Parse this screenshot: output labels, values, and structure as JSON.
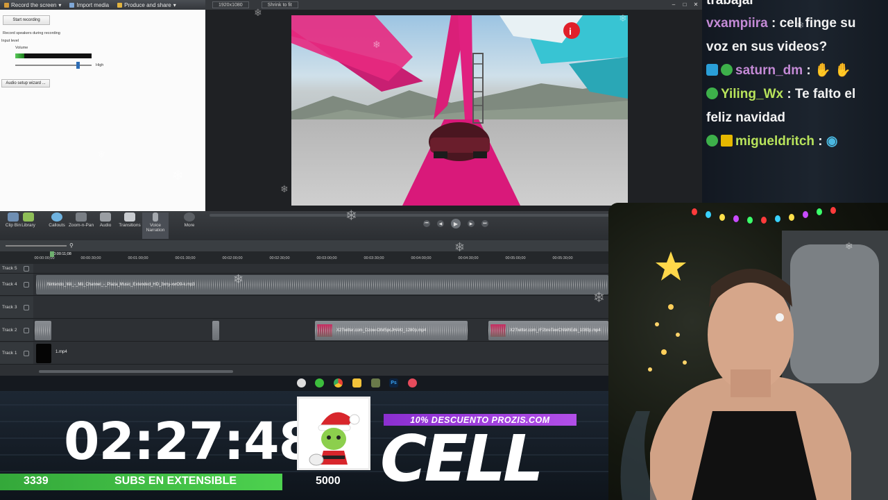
{
  "editor": {
    "menu": [
      "Record the screen",
      "Import media",
      "Produce and share"
    ],
    "recorder": {
      "start_button": "Start recording",
      "speakers_label": "Record speakers during recording",
      "input_level_label": "Input level",
      "volume_label": "Volume",
      "high_label": "High",
      "audio_setup_button": "Audio setup wizard ..."
    },
    "preview": {
      "resolution": "1920x1080",
      "fit": "Shrink to fit"
    },
    "tools": [
      "Clip Bin",
      "Library",
      "Callouts",
      "Zoom-n-Pan",
      "Audio",
      "Transitions",
      "Voice Narration",
      "More"
    ],
    "timeline": {
      "ticks": [
        "00:00:00;00",
        "00:00:30;00",
        "00:01:00;00",
        "00:01:30;00",
        "00:02:00;00",
        "00:02:30;00",
        "00:03:00;00",
        "00:03:30;00",
        "00:04:00;00",
        "00:04:30;00",
        "00:05:00;00",
        "00:05:30;00"
      ],
      "playhead_time": "0:00:11;08",
      "tracks": [
        {
          "label": "Track 5"
        },
        {
          "label": "Track 4",
          "clip": "Nintendo_Wii_-_Mii_Channel_-_Plaza_Music_Extended_HD_3xny-xwO9-k.mp3"
        },
        {
          "label": "Track 3"
        },
        {
          "label": "Track 2",
          "clips": [
            "X2Twitter.com_Dzow-OIM5pcJHAKt_1280p.mp4",
            "X2Twitter.com_rF2breTewCNWhEdk_1080p.mp4"
          ]
        },
        {
          "label": "Track 1",
          "clip": "1.mp4"
        }
      ]
    }
  },
  "chat": {
    "lines": [
      {
        "user": "",
        "text": "trabajar"
      },
      {
        "user": "vxampiira",
        "text": " : cell finge su voz en sus videos?",
        "color": "#c48ad6"
      },
      {
        "user": "saturn_dm",
        "text": " :",
        "color": "#c48ad6"
      },
      {
        "user": "Yiling_Wx",
        "text": " : Te falto el feliz navidad",
        "color": "#b8e35b"
      },
      {
        "user": "migueldritch",
        "text": " :",
        "color": "#b8e35b"
      }
    ]
  },
  "overlay": {
    "timer": "02:27:48",
    "subs_current": "3339",
    "subs_label": "SUBS EN EXTENSIBLE",
    "subs_goal": "5000",
    "subs_progress": 0.6678,
    "promo": "10% DESCUENTO PROZIS.COM",
    "brand": "CELL"
  },
  "colors": {
    "accent_green": "#46c84a",
    "promo_purple": "#a040e0",
    "track_magenta": "#e0207f"
  }
}
